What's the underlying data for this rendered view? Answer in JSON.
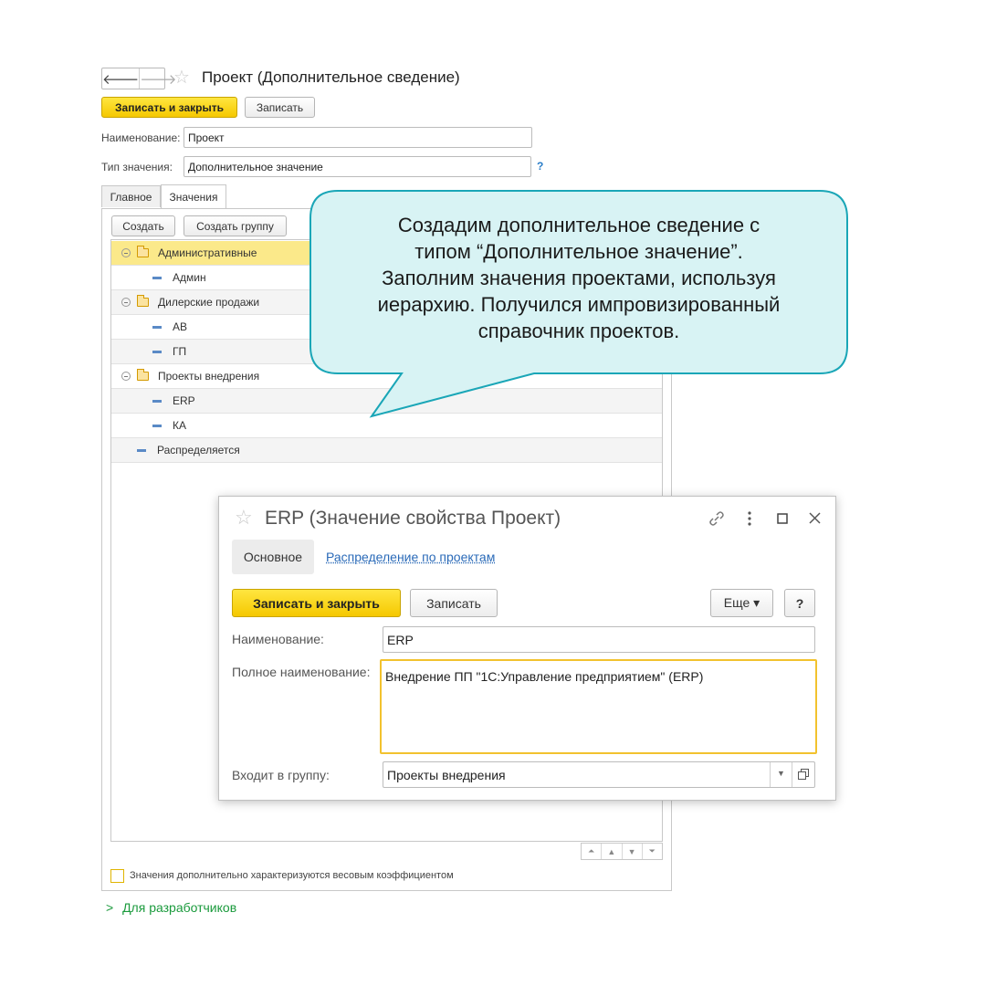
{
  "colors": {
    "accent_yellow": "#f5c800",
    "selected_row": "#fbe98a",
    "callout_fill": "#d8f3f4",
    "callout_stroke": "#1aa6b7",
    "link_blue": "#2a6ab8",
    "dev_green": "#1a9a3c"
  },
  "main": {
    "title": "Проект (Дополнительное сведение)",
    "nav_back": "🡐",
    "nav_forward": "🡒",
    "star": "☆",
    "save_close": "Записать и закрыть",
    "save": "Записать",
    "name_label": "Наименование:",
    "name_value": "Проект",
    "type_label": "Тип значения:",
    "type_value": "Дополнительное значение",
    "help": "?",
    "tabs": [
      {
        "label": "Главное"
      },
      {
        "label": "Значения"
      }
    ],
    "create": "Создать",
    "create_group": "Создать группу",
    "tree": [
      {
        "label": "Административные"
      },
      {
        "label": "Админ"
      },
      {
        "label": "Дилерские продажи"
      },
      {
        "label": "АВ"
      },
      {
        "label": "ГП"
      },
      {
        "label": "Проекты внедрения"
      },
      {
        "label": "ERP"
      },
      {
        "label": "КА"
      },
      {
        "label": "Распределяется"
      }
    ],
    "checkbox_label": "Значения дополнительно характеризуются весовым коэффициентом",
    "developers_chevron": ">",
    "developers_link": "Для разработчиков"
  },
  "callout": {
    "lines": [
      "Создадим дополнительное сведение с",
      "типом “Дополнительное значение”.",
      "Заполним значения проектами, используя",
      "иерархию. Получился импровизированный",
      "справочник проектов."
    ]
  },
  "dialog": {
    "title": "ERP (Значение свойства Проект)",
    "tab_main": "Основное",
    "tab_link": "Распределение по проектам",
    "save_close": "Записать и закрыть",
    "save": "Записать",
    "more": "Еще ▾",
    "help": "?",
    "name_label": "Наименование:",
    "name_value": "ERP",
    "fullname_label": "Полное наименование:",
    "fullname_value": "Внедрение ПП \"1С:Управление предприятием\" (ERP)",
    "group_label": "Входит в группу:",
    "group_value": "Проекты внедрения"
  }
}
